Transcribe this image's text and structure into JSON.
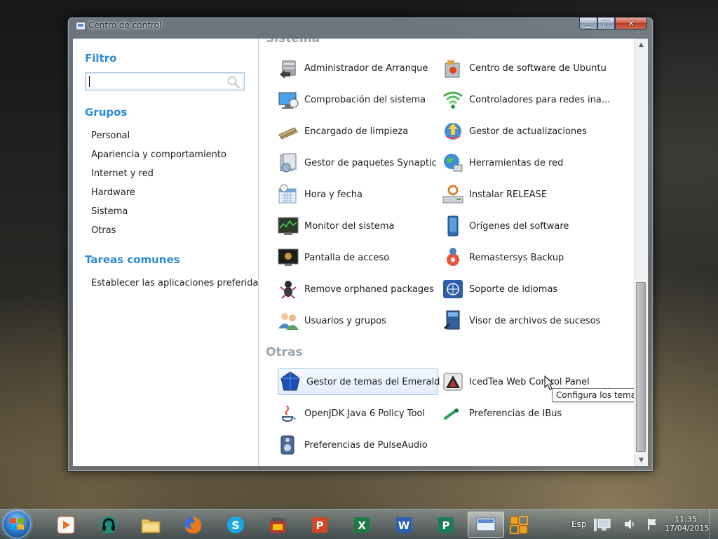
{
  "window": {
    "title": "Centro de control",
    "controls": {
      "minimize": "▁",
      "maximize": "□",
      "close": "✕"
    }
  },
  "sidebar": {
    "filter_heading": "Filtro",
    "search": {
      "value": "",
      "placeholder": ""
    },
    "groups_heading": "Grupos",
    "groups": [
      "Personal",
      "Apariencia y comportamiento",
      "Internet y red",
      "Hardware",
      "Sistema",
      "Otras"
    ],
    "tasks_heading": "Tareas comunes",
    "tasks": [
      "Establecer las aplicaciones preferidas"
    ]
  },
  "main": {
    "sections": [
      {
        "title": "Sistema",
        "items": [
          {
            "label": "Administrador de Arranque",
            "icon": "boot-manager-icon"
          },
          {
            "label": "Centro de software de Ubuntu",
            "icon": "software-center-icon"
          },
          {
            "label": "Comprobación del sistema",
            "icon": "system-check-icon"
          },
          {
            "label": "Controladores para redes ina...",
            "icon": "wireless-icon"
          },
          {
            "label": "Encargado de limpieza",
            "icon": "cleanup-icon"
          },
          {
            "label": "Gestor de actualizaciones",
            "icon": "update-manager-icon"
          },
          {
            "label": "Gestor de paquetes Synaptic",
            "icon": "synaptic-icon"
          },
          {
            "label": "Herramientas de red",
            "icon": "network-tools-icon"
          },
          {
            "label": "Hora y fecha",
            "icon": "calendar-icon"
          },
          {
            "label": "Instalar RELEASE",
            "icon": "install-release-icon"
          },
          {
            "label": "Monitor del sistema",
            "icon": "system-monitor-icon"
          },
          {
            "label": "Orígenes del software",
            "icon": "software-sources-icon"
          },
          {
            "label": "Pantalla de acceso",
            "icon": "login-screen-icon"
          },
          {
            "label": "Remastersys Backup",
            "icon": "remastersys-icon"
          },
          {
            "label": "Remove orphaned packages",
            "icon": "orphan-packages-icon"
          },
          {
            "label": "Soporte de idiomas",
            "icon": "language-support-icon"
          },
          {
            "label": "Usuarios y grupos",
            "icon": "users-groups-icon"
          },
          {
            "label": "Visor de archivos de sucesos",
            "icon": "log-viewer-icon"
          }
        ]
      },
      {
        "title": "Otras",
        "items": [
          {
            "label": "Gestor de temas del Emerald",
            "icon": "emerald-theme-icon"
          },
          {
            "label": "IcedTea Web Control Panel",
            "icon": "icedtea-icon"
          },
          {
            "label": "OpenJDK Java 6 Policy Tool",
            "icon": "java-icon"
          },
          {
            "label": "Preferencias de IBus",
            "icon": "ibus-icon"
          },
          {
            "label": "Preferencias de PulseAudio",
            "icon": "pulseaudio-icon"
          }
        ]
      }
    ],
    "hovered_item": "Gestor de temas del Emerald",
    "tooltip": "Configura los temas del Emerald"
  },
  "taskbar": {
    "apps": [
      {
        "name": "media-player-icon"
      },
      {
        "name": "music-app-icon"
      },
      {
        "name": "file-manager-icon"
      },
      {
        "name": "firefox-icon"
      },
      {
        "name": "skype-icon"
      },
      {
        "name": "video-editor-icon"
      },
      {
        "name": "powerpoint-icon"
      },
      {
        "name": "excel-icon"
      },
      {
        "name": "word-icon"
      },
      {
        "name": "publisher-icon"
      },
      {
        "name": "control-center-icon",
        "active": true
      },
      {
        "name": "access-icon"
      }
    ],
    "language": "Esp",
    "time": "11:35",
    "date": "17/04/2015"
  },
  "colors": {
    "heading_blue": "#2b8ad6",
    "section_gray": "#9aa4ad",
    "hover_border": "#9ec3e6"
  }
}
